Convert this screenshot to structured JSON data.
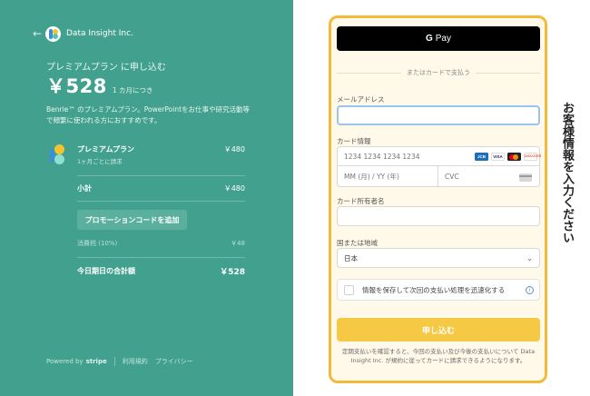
{
  "merchant": {
    "name": "Data Insight Inc."
  },
  "summary": {
    "title": "プレミアムプラン に申し込む",
    "price": "￥528",
    "period": "1 カ月につき",
    "description": "Benrie™ のプレミアムプラン。PowerPointをお仕事や研究活動等で頻繁に使われる方におすすめです。"
  },
  "line_item": {
    "name": "プレミアムプラン",
    "billing": "1ヶ月ごとに請求",
    "price": "￥480"
  },
  "subtotal": {
    "label": "小計",
    "value": "￥480"
  },
  "promo_button": "プロモーションコードを追加",
  "tax": {
    "label": "消費税 (10%)",
    "value": "￥48"
  },
  "total": {
    "label": "今日期日の合計額",
    "value": "￥528"
  },
  "footer": {
    "powered_by": "Powered by",
    "stripe": "stripe",
    "terms": "利用規約",
    "privacy": "プライバシー"
  },
  "payment": {
    "gpay_g": "G",
    "gpay_label": "Pay",
    "divider": "またはカードで支払う",
    "email_label": "メールアドレス",
    "email_value": "",
    "card_label": "カード情報",
    "card_number_placeholder": "1234 1234 1234 1234",
    "expiry_placeholder": "MM (月) / YY (年)",
    "cvc_placeholder": "CVC",
    "card_brands": [
      "JCB",
      "VISA",
      "MC",
      "DISCOVER"
    ],
    "holder_label": "カード所有者名",
    "holder_value": "",
    "country_label": "国または地域",
    "country_value": "日本",
    "save_info": "情報を保存して次回の支払い処理を迅速化する",
    "info_icon": "i",
    "submit": "申し込む",
    "terms_text": "定期支払いを確認すると、今回の支払い及び今後の支払いについて Data Insight Inc. が規約に従ってカードに請求できるようになります。"
  },
  "callout": "お客様情報を入力ください",
  "colors": {
    "left_bg": "#42a08e",
    "form_border": "#f2b93b",
    "form_bg": "#fef9e8",
    "submit_bg": "#f6c945"
  }
}
